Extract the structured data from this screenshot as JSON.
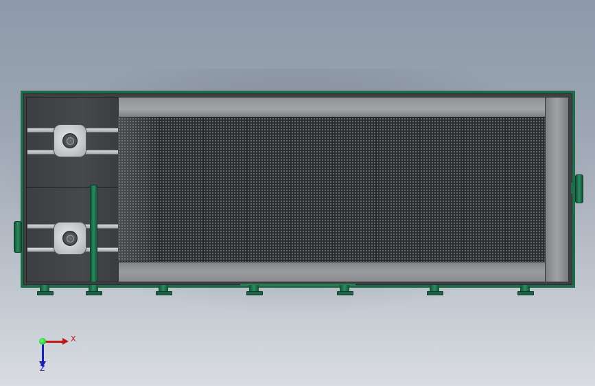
{
  "viewport": {
    "background": "#9aa4b2",
    "frame_color": "#1f6b4a",
    "mesh_color": "#2b2d30",
    "channel_color": "#9a9c9f"
  },
  "icons": {
    "motor_top": "motor-icon",
    "motor_bottom": "motor-icon",
    "triad": "coordinate-axes-icon"
  },
  "axes": {
    "x_label": "X",
    "z_label": "Z",
    "x_color": "#c2161b",
    "z_color": "#1a21b8",
    "origin_color": "#1aa52a"
  }
}
